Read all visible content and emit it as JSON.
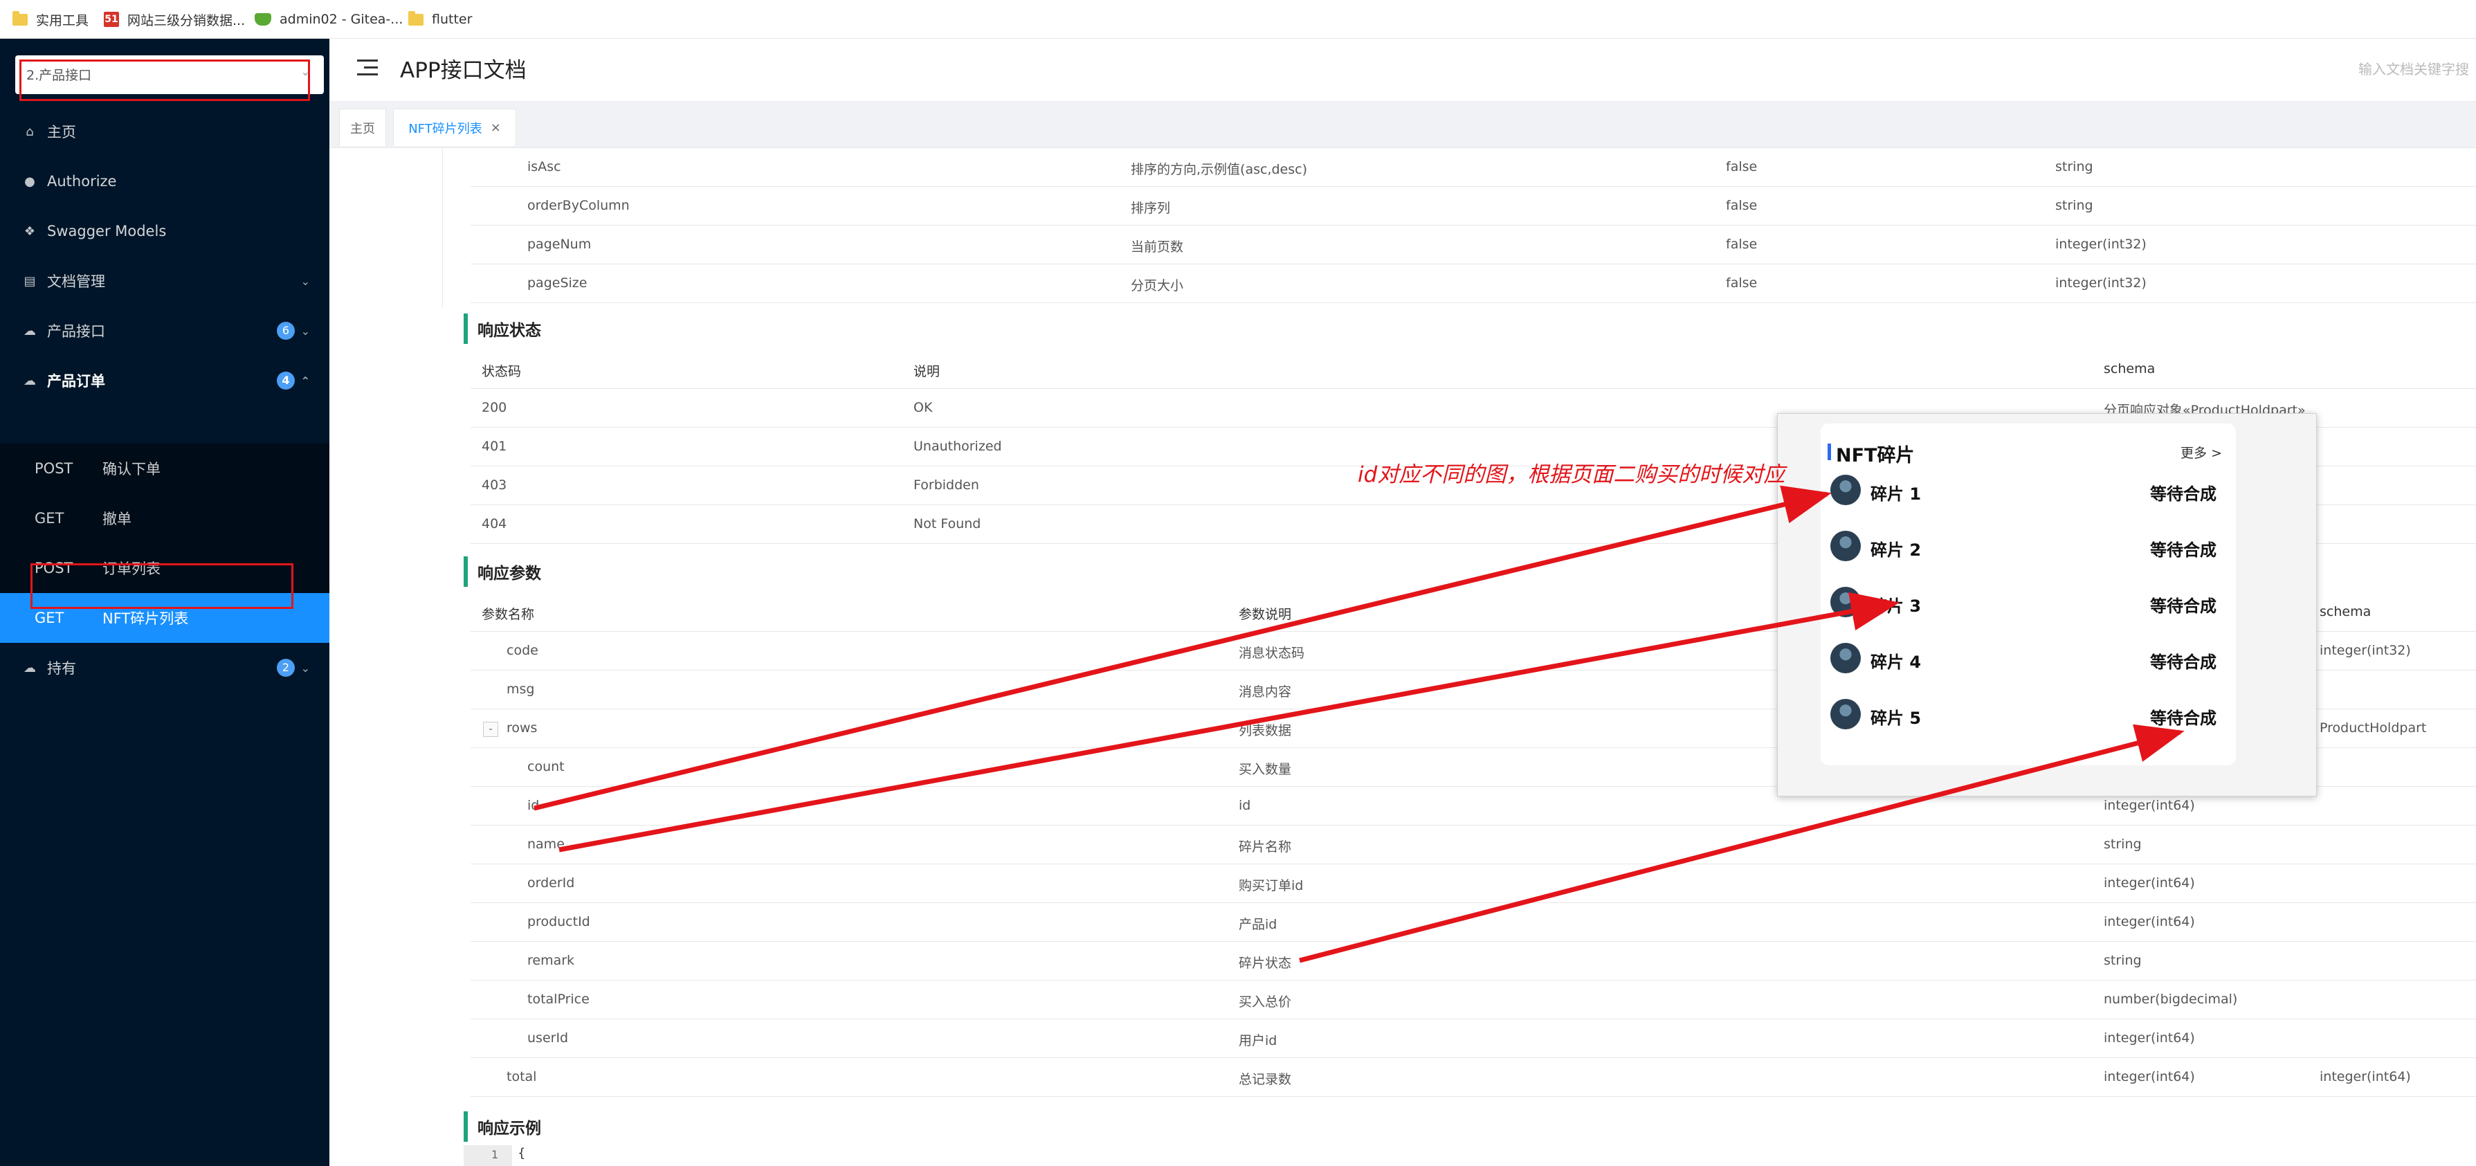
{
  "bookmarks": [
    {
      "label": "实用工具",
      "icon": "folder-icon"
    },
    {
      "label": "网站三级分销数据...",
      "icon": "site-51-icon"
    },
    {
      "label": "admin02 - Gitea-...",
      "icon": "gitea-icon"
    },
    {
      "label": "flutter",
      "icon": "folder-icon"
    }
  ],
  "sidebar": {
    "project": "2.产品接口",
    "items": [
      {
        "label": "主页",
        "icon": "home-icon"
      },
      {
        "label": "Authorize",
        "icon": "lock-icon"
      },
      {
        "label": "Swagger Models",
        "icon": "cube-icon"
      },
      {
        "label": "文档管理",
        "icon": "file-icon"
      },
      {
        "label": "产品接口",
        "icon": "cloud-icon",
        "badge": "6"
      },
      {
        "label": "产品订单",
        "icon": "cloud-icon",
        "badge": "4"
      },
      {
        "label": "持有",
        "icon": "cloud-icon",
        "badge": "2"
      }
    ],
    "sub": [
      {
        "method": "POST",
        "name": "确认下单"
      },
      {
        "method": "GET",
        "name": "撤单"
      },
      {
        "method": "POST",
        "name": "订单列表"
      },
      {
        "method": "GET",
        "name": "NFT碎片列表"
      }
    ]
  },
  "header": {
    "title": "APP接口文档",
    "search_placeholder": "输入文档关键字搜"
  },
  "tabs": [
    {
      "label": "主页"
    },
    {
      "label": "NFT碎片列表",
      "close": "×"
    }
  ],
  "request_params": [
    {
      "name": "isAsc",
      "desc": "排序的方向,示例值(asc,desc)",
      "required": "false",
      "type": "string"
    },
    {
      "name": "orderByColumn",
      "desc": "排序列",
      "required": "false",
      "type": "string"
    },
    {
      "name": "pageNum",
      "desc": "当前页数",
      "required": "false",
      "type": "integer(int32)"
    },
    {
      "name": "pageSize",
      "desc": "分页大小",
      "required": "false",
      "type": "integer(int32)"
    }
  ],
  "response_status": {
    "title": "响应状态",
    "headers": [
      "状态码",
      "说明",
      "schema"
    ],
    "rows": [
      {
        "code": "200",
        "desc": "OK",
        "schema": "分页响应对象«ProductHoldpart»"
      },
      {
        "code": "401",
        "desc": "Unauthorized",
        "schema": ""
      },
      {
        "code": "403",
        "desc": "Forbidden",
        "schema": ""
      },
      {
        "code": "404",
        "desc": "Not Found",
        "schema": ""
      }
    ]
  },
  "response_params": {
    "title": "响应参数",
    "headers": [
      "参数名称",
      "参数说明",
      "schema"
    ],
    "rows": [
      {
        "name": "code",
        "desc": "消息状态码",
        "type": "",
        "schema": "integer(int32)"
      },
      {
        "name": "msg",
        "desc": "消息内容",
        "type": "",
        "schema": ""
      },
      {
        "name": "rows",
        "desc": "列表数据",
        "type": "",
        "schema": "ProductHoldpart",
        "expand": "-"
      },
      {
        "name": "count",
        "desc": "买入数量",
        "type": "",
        "schema": ""
      },
      {
        "name": "id",
        "desc": "id",
        "type": "integer(int64)",
        "schema": ""
      },
      {
        "name": "name",
        "desc": "碎片名称",
        "type": "string",
        "schema": ""
      },
      {
        "name": "orderId",
        "desc": "购买订单id",
        "type": "integer(int64)",
        "schema": ""
      },
      {
        "name": "productId",
        "desc": "产品id",
        "type": "integer(int64)",
        "schema": ""
      },
      {
        "name": "remark",
        "desc": "碎片状态",
        "type": "string",
        "schema": ""
      },
      {
        "name": "totalPrice",
        "desc": "买入总价",
        "type": "number(bigdecimal)",
        "schema": ""
      },
      {
        "name": "userId",
        "desc": "用户id",
        "type": "integer(int64)",
        "schema": ""
      },
      {
        "name": "total",
        "desc": "总记录数",
        "type": "integer(int64)",
        "schema": "integer(int64)"
      }
    ]
  },
  "response_example": {
    "title": "响应示例",
    "line": "1",
    "code": "{"
  },
  "overlay": {
    "title": "NFT碎片",
    "more": "更多 >",
    "items": [
      {
        "name": "碎片 1",
        "status": "等待合成"
      },
      {
        "name": "碎片 2",
        "status": "等待合成"
      },
      {
        "name": "碎片 3",
        "status": "等待合成"
      },
      {
        "name": "碎片 4",
        "status": "等待合成"
      },
      {
        "name": "碎片 5",
        "status": "等待合成"
      }
    ]
  },
  "annotation": "id对应不同的图，根据页面二购买的时候对应",
  "colors": {
    "sidebar": "#001529",
    "active": "#1890ff",
    "section_accent": "#1ea37d",
    "annotation": "#e3151a"
  }
}
